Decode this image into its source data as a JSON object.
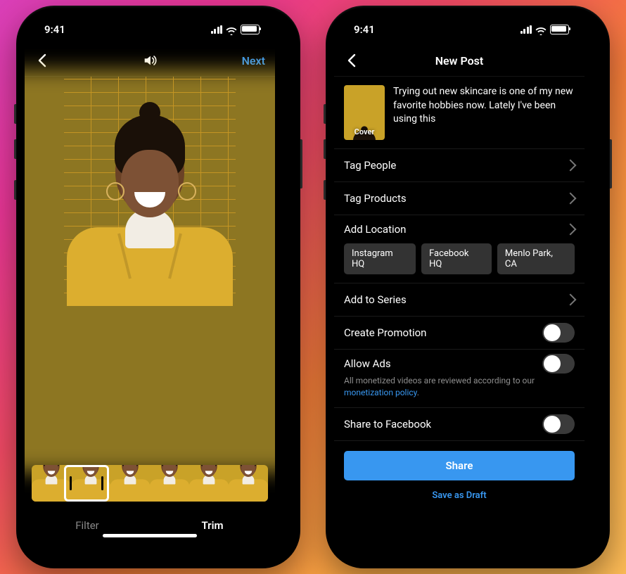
{
  "status_time": "9:41",
  "phoneA": {
    "next": "Next",
    "tabs": {
      "filter": "Filter",
      "trim": "Trim"
    }
  },
  "phoneB": {
    "title": "New Post",
    "caption": "Trying out new skincare is one of my new favorite hobbies now. Lately I've been using this",
    "cover_label": "Cover",
    "rows": {
      "tag_people": "Tag People",
      "tag_products": "Tag Products",
      "add_location": "Add Location",
      "add_series": "Add to Series",
      "create_promotion": "Create Promotion",
      "allow_ads": "Allow Ads",
      "share_fb": "Share to Facebook"
    },
    "location_chips": [
      "Instagram HQ",
      "Facebook HQ",
      "Menlo Park, CA"
    ],
    "ads_subtext_pre": "All monetized videos are reviewed according to our ",
    "ads_subtext_link": "monetization policy",
    "ads_subtext_post": ".",
    "share_btn": "Share",
    "save_draft": "Save as Draft"
  }
}
